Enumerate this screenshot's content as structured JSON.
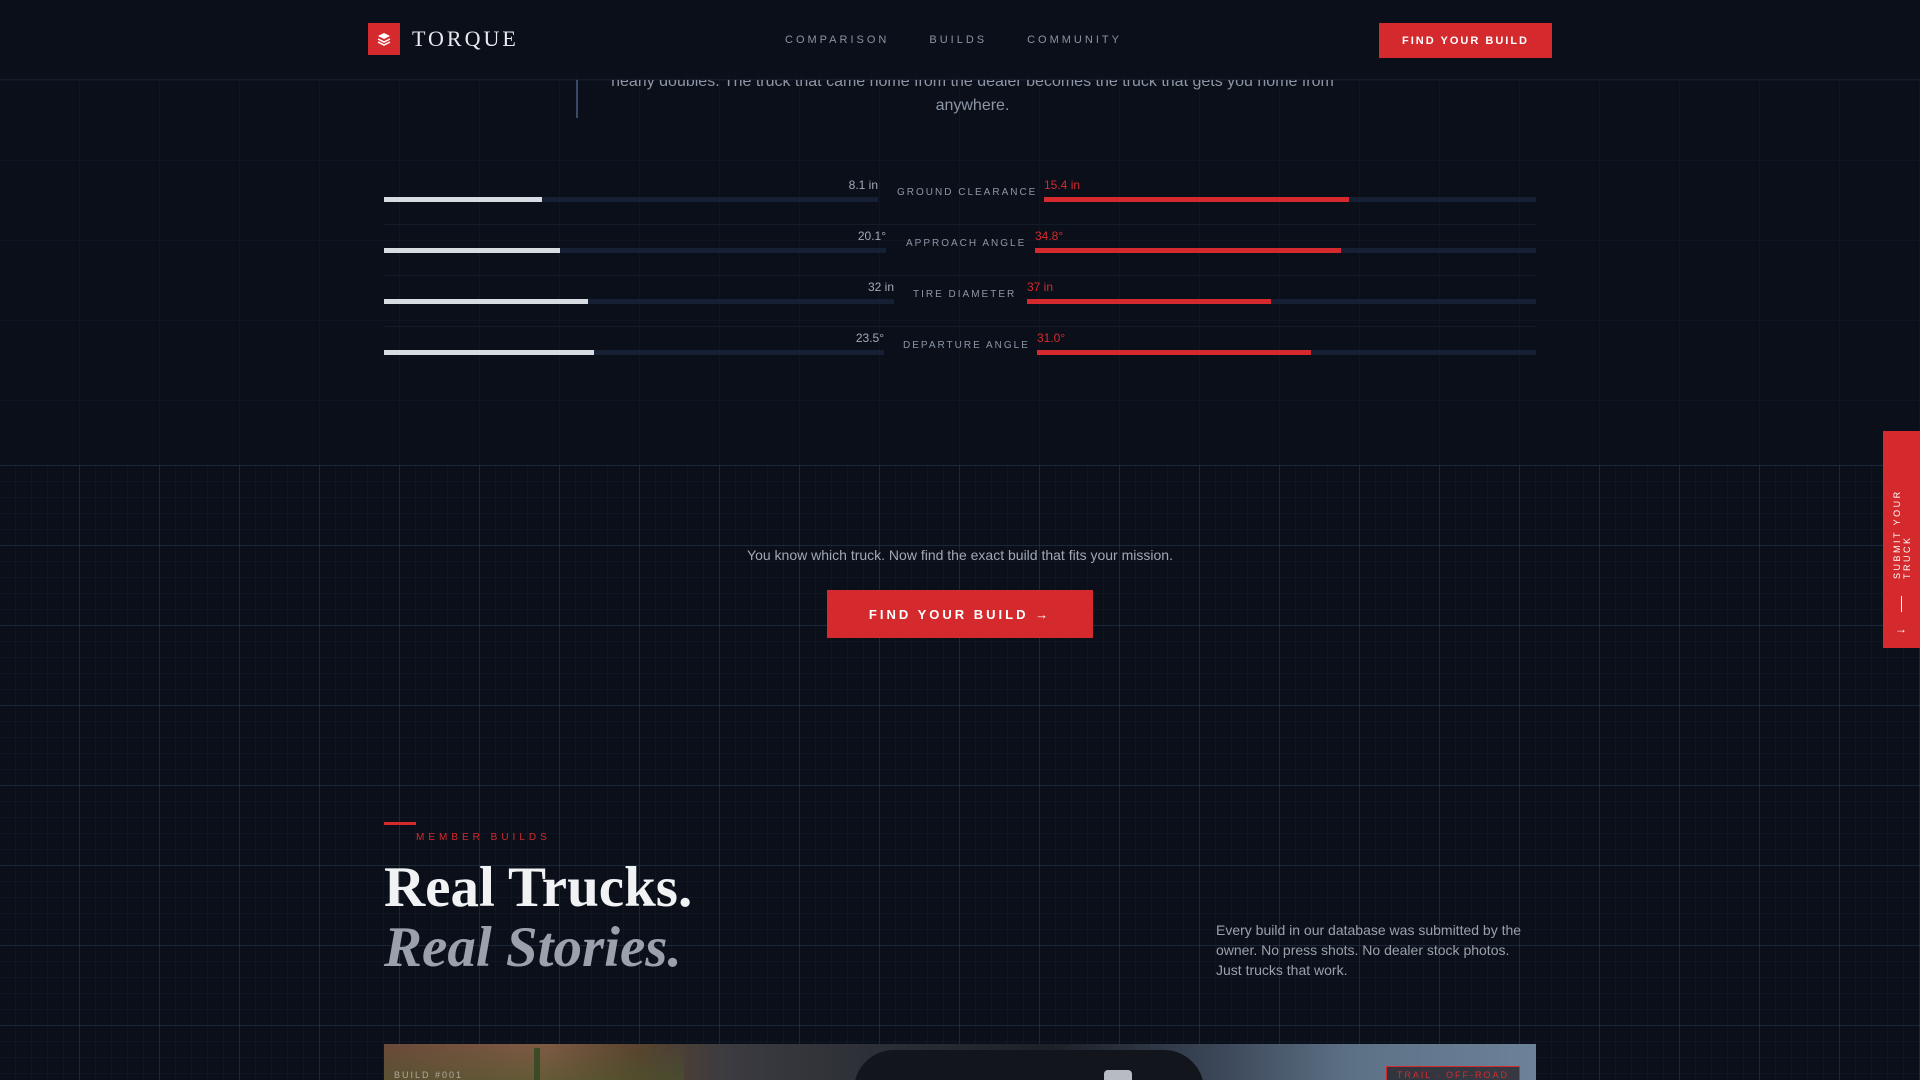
{
  "brand": {
    "name": "TORQUE",
    "accent": "#d42a2e"
  },
  "nav": [
    {
      "label": "COMPARISON"
    },
    {
      "label": "BUILDS"
    },
    {
      "label": "COMMUNITY"
    }
  ],
  "header_cta": "FIND YOUR BUILD",
  "quote": {
    "line1": "nearly doubles. The truck that came home from the dealer becomes the truck that gets you home from",
    "line2": "anywhere."
  },
  "comparison": [
    {
      "label": "GROUND CLEARANCE",
      "stock": "8.1 in",
      "built": "15.4 in",
      "stock_level": 0.32,
      "built_level": 0.62
    },
    {
      "label": "APPROACH ANGLE",
      "stock": "20.1°",
      "built": "34.8°",
      "stock_level": 0.35,
      "built_level": 0.61
    },
    {
      "label": "TIRE DIAMETER",
      "stock": "32 in",
      "built": "37 in",
      "stock_level": 0.4,
      "built_level": 0.48
    },
    {
      "label": "DEPARTURE ANGLE",
      "stock": "23.5°",
      "built": "31.0°",
      "stock_level": 0.42,
      "built_level": 0.55
    }
  ],
  "cta": {
    "text": "You know which truck. Now find the exact build that fits your mission.",
    "button": "FIND YOUR BUILD →"
  },
  "side_tab": {
    "label": "SUBMIT YOUR TRUCK",
    "arrow": "→"
  },
  "member_builds": {
    "eyebrow": "MEMBER BUILDS",
    "title_line1": "Real Trucks.",
    "title_line2": "Real Stories.",
    "intro": "Every build in our database was submitted by the owner. No press shots. No dealer stock photos. Just trucks that work.",
    "photo_tag": "TRAIL · OFF-ROAD",
    "photo_caption": "BUILD #001"
  }
}
